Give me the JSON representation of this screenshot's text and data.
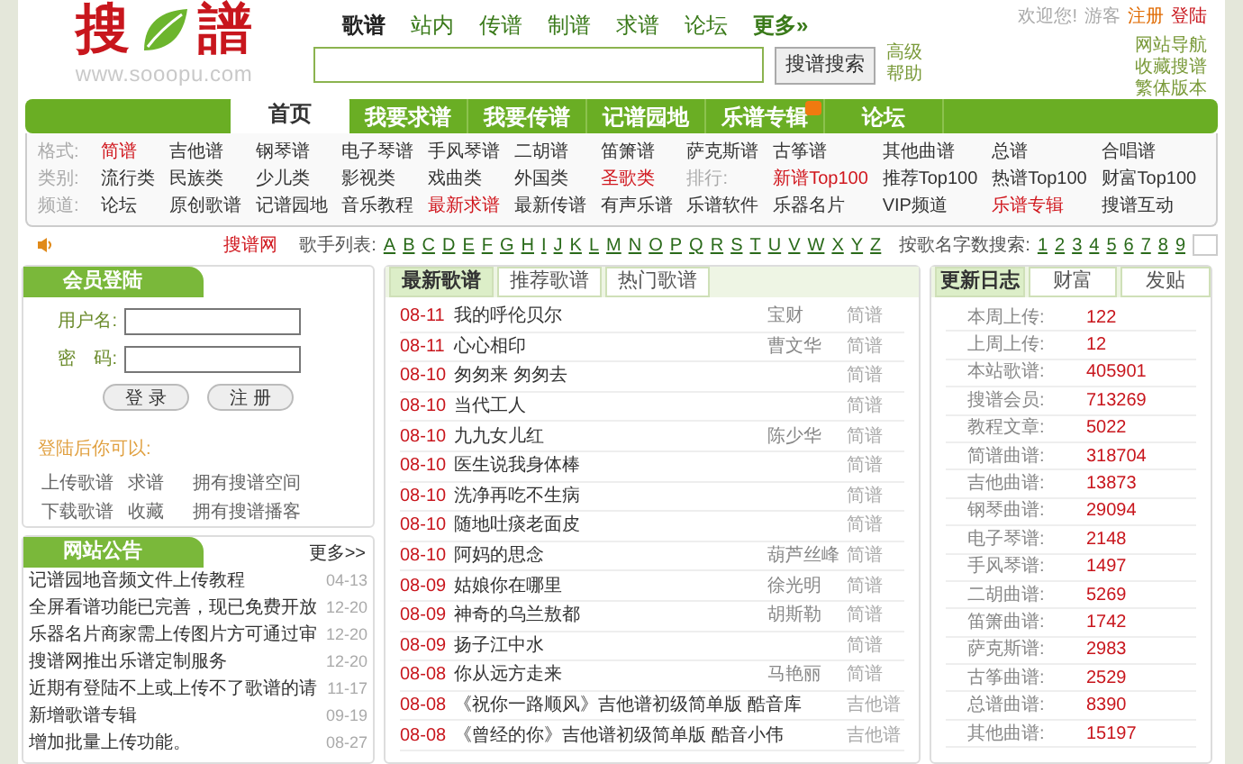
{
  "header": {
    "logo": {
      "char_1": "搜",
      "char_2": "譜",
      "url": "www.sooopu.com"
    },
    "search_tabs": [
      {
        "label": "歌谱",
        "selected": true
      },
      {
        "label": "站内",
        "selected": false
      },
      {
        "label": "传谱",
        "selected": false
      },
      {
        "label": "制谱",
        "selected": false
      },
      {
        "label": "求谱",
        "selected": false
      },
      {
        "label": "论坛",
        "selected": false
      }
    ],
    "more_link": "更多»",
    "search": {
      "button": "搜谱搜索",
      "links": [
        "高级",
        "帮助"
      ]
    },
    "user_bar": {
      "welcome": "欢迎您!",
      "guest": "游客",
      "register": "注册",
      "login": "登陆"
    },
    "side_links": [
      "网站导航",
      "收藏搜谱",
      "繁体版本"
    ]
  },
  "nav": {
    "tabs": [
      {
        "label": "首页",
        "selected": true,
        "hot": false
      },
      {
        "label": "我要求谱",
        "selected": false,
        "hot": false
      },
      {
        "label": "我要传谱",
        "selected": false,
        "hot": false
      },
      {
        "label": "记谱园地",
        "selected": false,
        "hot": false
      },
      {
        "label": "乐谱专辑",
        "selected": false,
        "hot": true
      },
      {
        "label": "论坛",
        "selected": false,
        "hot": false
      }
    ]
  },
  "categories": [
    {
      "label": "格式:",
      "items": [
        {
          "kind": "link",
          "text": "简谱",
          "highlighted": true
        },
        {
          "kind": "link",
          "text": "吉他谱",
          "highlighted": false
        },
        {
          "kind": "link",
          "text": "钢琴谱",
          "highlighted": false
        },
        {
          "kind": "link",
          "text": "电子琴谱",
          "highlighted": false
        },
        {
          "kind": "link",
          "text": "手风琴谱",
          "highlighted": false
        },
        {
          "kind": "link",
          "text": "二胡谱",
          "highlighted": false
        },
        {
          "kind": "link",
          "text": "笛箫谱",
          "highlighted": false
        },
        {
          "kind": "link",
          "text": "萨克斯谱",
          "highlighted": false
        },
        {
          "kind": "link",
          "text": "古筝谱",
          "highlighted": false
        },
        {
          "kind": "link",
          "text": "其他曲谱",
          "highlighted": false
        },
        {
          "kind": "link",
          "text": "总谱",
          "highlighted": false
        },
        {
          "kind": "link",
          "text": "合唱谱",
          "highlighted": false
        }
      ]
    },
    {
      "label": "类别:",
      "items": [
        {
          "kind": "link",
          "text": "流行类",
          "highlighted": false
        },
        {
          "kind": "link",
          "text": "民族类",
          "highlighted": false
        },
        {
          "kind": "link",
          "text": "少儿类",
          "highlighted": false
        },
        {
          "kind": "link",
          "text": "影视类",
          "highlighted": false
        },
        {
          "kind": "link",
          "text": "戏曲类",
          "highlighted": false
        },
        {
          "kind": "link",
          "text": "外国类",
          "highlighted": false
        },
        {
          "kind": "link",
          "text": "圣歌类",
          "highlighted": true
        },
        {
          "kind": "label",
          "text": "排行:",
          "highlighted": false
        },
        {
          "kind": "link",
          "text": "新谱Top100",
          "highlighted": true
        },
        {
          "kind": "link",
          "text": "推荐Top100",
          "highlighted": false
        },
        {
          "kind": "link",
          "text": "热谱Top100",
          "highlighted": false
        },
        {
          "kind": "link",
          "text": "财富Top100",
          "highlighted": false
        }
      ]
    },
    {
      "label": "频道:",
      "items": [
        {
          "kind": "link",
          "text": "论坛",
          "highlighted": false
        },
        {
          "kind": "link",
          "text": "原创歌谱",
          "highlighted": false
        },
        {
          "kind": "link",
          "text": "记谱园地",
          "highlighted": false
        },
        {
          "kind": "link",
          "text": "音乐教程",
          "highlighted": false
        },
        {
          "kind": "link",
          "text": "最新求谱",
          "highlighted": true
        },
        {
          "kind": "link",
          "text": "最新传谱",
          "highlighted": false
        },
        {
          "kind": "link",
          "text": "有声乐谱",
          "highlighted": false
        },
        {
          "kind": "link",
          "text": "乐谱软件",
          "highlighted": false
        },
        {
          "kind": "link",
          "text": "乐器名片",
          "highlighted": false
        },
        {
          "kind": "link",
          "text": "VIP频道",
          "highlighted": false
        },
        {
          "kind": "link",
          "text": "乐谱专辑",
          "highlighted": true
        },
        {
          "kind": "link",
          "text": "搜谱互动",
          "highlighted": false
        }
      ]
    }
  ],
  "letter_bar": {
    "site": "搜谱网",
    "singer_label": "歌手列表:",
    "letters": [
      "A",
      "B",
      "C",
      "D",
      "E",
      "F",
      "G",
      "H",
      "I",
      "J",
      "K",
      "L",
      "M",
      "N",
      "O",
      "P",
      "Q",
      "R",
      "S",
      "T",
      "U",
      "V",
      "W",
      "X",
      "Y",
      "Z"
    ],
    "count_label": "按歌名字数搜索:",
    "counts": [
      "1",
      "2",
      "3",
      "4",
      "5",
      "6",
      "7",
      "8",
      "9"
    ]
  },
  "login": {
    "title": "会员登陆",
    "username_label": "用户名:",
    "password_label": "密　码:",
    "login_button": "登 录",
    "register_button": "注 册",
    "perks_title": "登陆后你可以:",
    "perks": [
      "上传歌谱",
      "求谱",
      "拥有搜谱空间",
      "下载歌谱",
      "收藏",
      "拥有搜谱播客"
    ]
  },
  "notices": {
    "title": "网站公告",
    "more": "更多>>",
    "items": [
      {
        "title": "记谱园地音频文件上传教程",
        "date": "04-13"
      },
      {
        "title": "全屏看谱功能已完善，现已免费开放",
        "date": "12-20"
      },
      {
        "title": "乐器名片商家需上传图片方可通过审",
        "date": "12-20"
      },
      {
        "title": "搜谱网推出乐谱定制服务",
        "date": "12-20"
      },
      {
        "title": "近期有登陆不上或上传不了歌谱的请",
        "date": "11-17"
      },
      {
        "title": "新增歌谱专辑",
        "date": "09-19"
      },
      {
        "title": "增加批量上传功能。",
        "date": "08-27"
      }
    ]
  },
  "songs": {
    "tabs": [
      {
        "label": "最新歌谱",
        "selected": true
      },
      {
        "label": "推荐歌谱",
        "selected": false
      },
      {
        "label": "热门歌谱",
        "selected": false
      }
    ],
    "rows": [
      {
        "date": "08-11",
        "title": "我的呼伦贝尔",
        "author": "宝财",
        "type": "简谱"
      },
      {
        "date": "08-11",
        "title": "心心相印",
        "author": "曹文华",
        "type": "简谱"
      },
      {
        "date": "08-10",
        "title": "匆匆来 匆匆去",
        "author": "",
        "type": "简谱"
      },
      {
        "date": "08-10",
        "title": "当代工人",
        "author": "",
        "type": "简谱"
      },
      {
        "date": "08-10",
        "title": "九九女儿红",
        "author": "陈少华",
        "type": "简谱"
      },
      {
        "date": "08-10",
        "title": "医生说我身体棒",
        "author": "",
        "type": "简谱"
      },
      {
        "date": "08-10",
        "title": "洗净再吃不生病",
        "author": "",
        "type": "简谱"
      },
      {
        "date": "08-10",
        "title": "随地吐痰老面皮",
        "author": "",
        "type": "简谱"
      },
      {
        "date": "08-10",
        "title": "阿妈的思念",
        "author": "葫芦丝峰",
        "type": "简谱"
      },
      {
        "date": "08-09",
        "title": "姑娘你在哪里",
        "author": "徐光明",
        "type": "简谱"
      },
      {
        "date": "08-09",
        "title": "神奇的乌兰敖都",
        "author": "胡斯勒",
        "type": "简谱"
      },
      {
        "date": "08-09",
        "title": "扬子江中水",
        "author": "",
        "type": "简谱"
      },
      {
        "date": "08-08",
        "title": "你从远方走来",
        "author": "马艳丽",
        "type": "简谱"
      },
      {
        "date": "08-08",
        "title": "《祝你一路顺风》吉他谱初级简单版 酷音库",
        "author": "",
        "type": "吉他谱"
      },
      {
        "date": "08-08",
        "title": "《曾经的你》吉他谱初级简单版 酷音小伟",
        "author": "",
        "type": "吉他谱"
      }
    ]
  },
  "stats": {
    "tabs": [
      {
        "label": "更新日志",
        "selected": true
      },
      {
        "label": "财富",
        "selected": false
      },
      {
        "label": "发贴",
        "selected": false
      }
    ],
    "rows": [
      {
        "label": "本周上传:",
        "value": "122"
      },
      {
        "label": "上周上传:",
        "value": "12"
      },
      {
        "label": "本站歌谱:",
        "value": "405901"
      },
      {
        "label": "搜谱会员:",
        "value": "713269"
      },
      {
        "label": "教程文章:",
        "value": "5022"
      },
      {
        "label": "简谱曲谱:",
        "value": "318704"
      },
      {
        "label": "吉他曲谱:",
        "value": "13873"
      },
      {
        "label": "钢琴曲谱:",
        "value": "29094"
      },
      {
        "label": "电子琴谱:",
        "value": "2148"
      },
      {
        "label": "手风琴谱:",
        "value": "1497"
      },
      {
        "label": "二胡曲谱:",
        "value": "5269"
      },
      {
        "label": "笛箫曲谱:",
        "value": "1742"
      },
      {
        "label": "萨克斯谱:",
        "value": "2983"
      },
      {
        "label": "古筝曲谱:",
        "value": "2529"
      },
      {
        "label": "总谱曲谱:",
        "value": "8390"
      },
      {
        "label": "其他曲谱:",
        "value": "15197"
      }
    ]
  }
}
